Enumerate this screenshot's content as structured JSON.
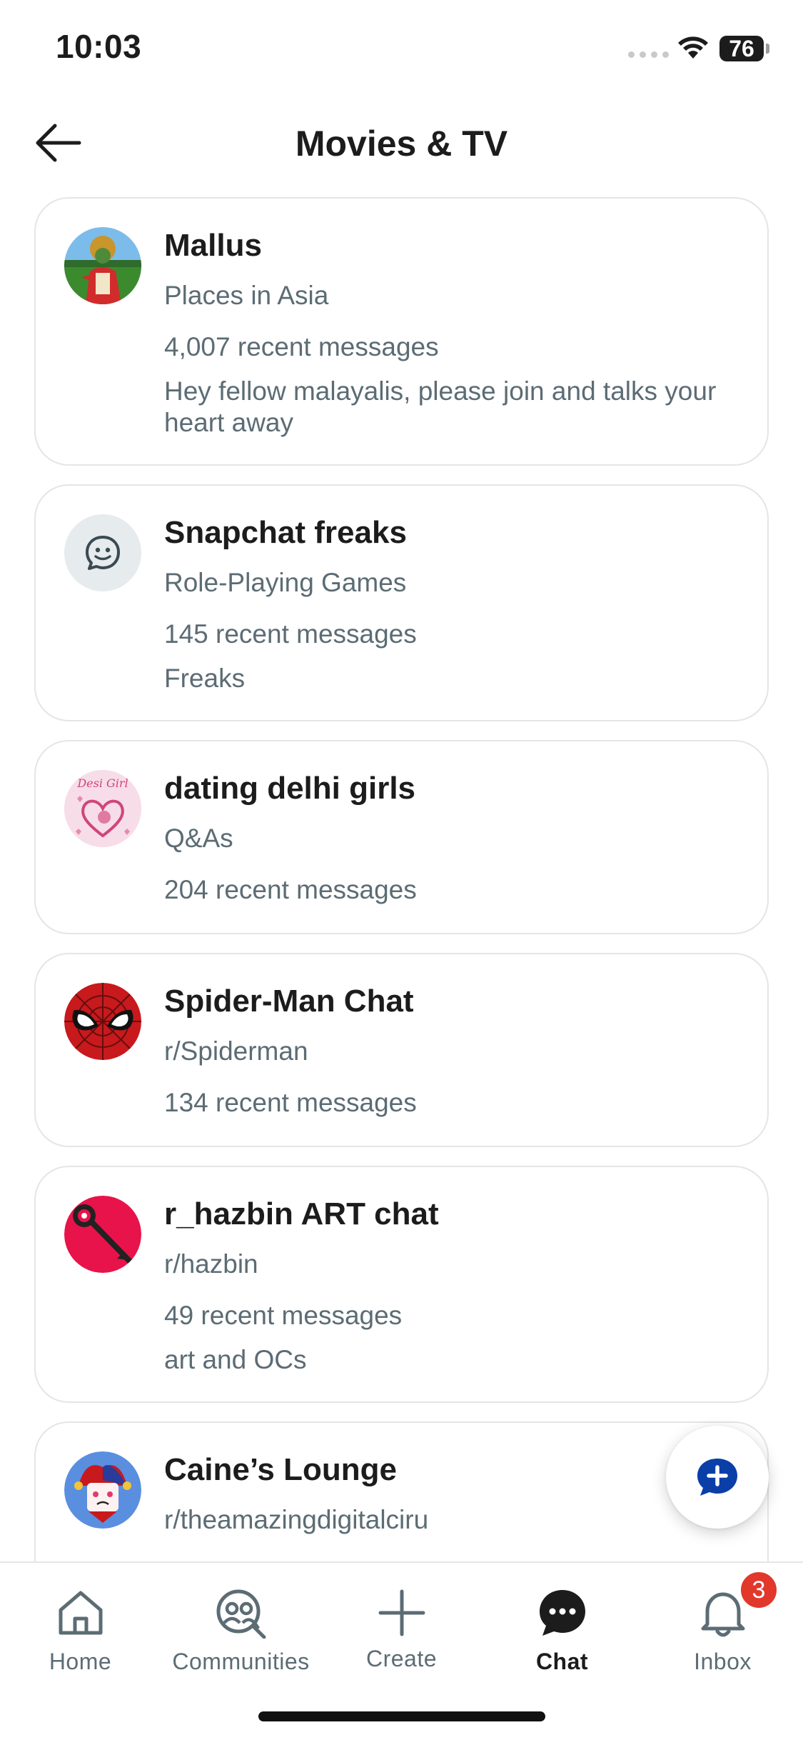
{
  "status_bar": {
    "time": "10:03",
    "battery": "76"
  },
  "header": {
    "title": "Movies & TV"
  },
  "chats": [
    {
      "name": "Mallus",
      "category": "Places in Asia",
      "recent": "4,007 recent messages",
      "description": "Hey fellow malayalis, please join and talks your heart away"
    },
    {
      "name": "Snapchat freaks",
      "category": "Role-Playing Games",
      "recent": "145 recent messages",
      "description": "Freaks"
    },
    {
      "name": "dating delhi girls",
      "category": "Q&As",
      "recent": "204 recent messages",
      "avatar_text": "Desi Girl"
    },
    {
      "name": "Spider-Man Chat",
      "category": "r/Spiderman",
      "recent": "134 recent messages"
    },
    {
      "name": "r_hazbin ART chat",
      "category": "r/hazbin",
      "recent": "49 recent messages",
      "description": "art and OCs"
    },
    {
      "name": "Caine’s Lounge",
      "category": "r/theamazingdigitalciru"
    }
  ],
  "bottom_nav": {
    "items": [
      {
        "label": "Home",
        "icon": "home-icon"
      },
      {
        "label": "Communities",
        "icon": "communities-icon"
      },
      {
        "label": "Create",
        "icon": "plus-icon"
      },
      {
        "label": "Chat",
        "icon": "chat-bubble-icon",
        "active": true
      },
      {
        "label": "Inbox",
        "icon": "bell-icon"
      }
    ],
    "inbox_badge": "3"
  },
  "colors": {
    "accent_blue": "#0a3fa8",
    "badge_red": "#e2372b",
    "muted_text": "#5c6c74",
    "card_border": "#e3e5e7"
  }
}
